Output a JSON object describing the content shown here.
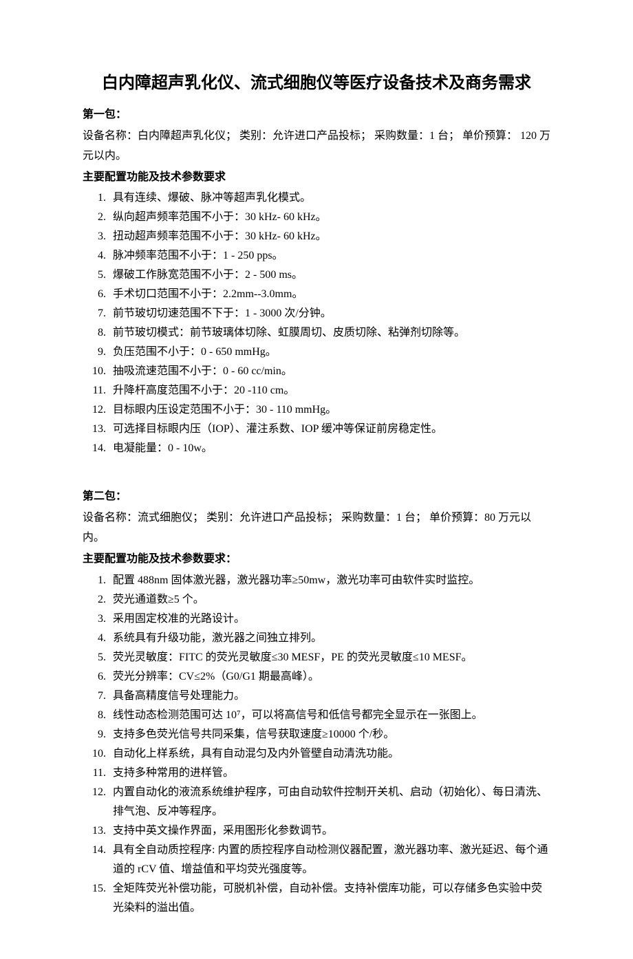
{
  "title": "白内障超声乳化仪、流式细胞仪等医疗设备技术及商务需求",
  "pkg1": {
    "label": "第一包：",
    "info": "设备名称：白内障超声乳化仪；   类别：允许进口产品投标；   采购数量：1 台；  单价预算：  120 万元以内。",
    "config_heading": "主要配置功能及技术参数要求",
    "items": [
      "具有连续、爆破、脉冲等超声乳化模式。",
      "纵向超声频率范围不小于：30 kHz- 60 kHz。",
      "扭动超声频率范围不小于：30 kHz- 60 kHz。",
      "脉冲频率范围不小于：1 - 250 pps。",
      "爆破工作脉宽范围不小于：2 - 500 ms。",
      "手术切口范围不小于：2.2mm--3.0mm。",
      "前节玻切切速范围不下于：1 - 3000 次/分钟。",
      "前节玻切模式：前节玻璃体切除、虹膜周切、皮质切除、粘弹剂切除等。",
      "负压范围不小于：0 - 650 mmHg。",
      "抽吸流速范围不小于：0 - 60 cc/min。",
      "升降杆高度范围不小于：20 -110 cm。",
      "目标眼内压设定范围不小于：30 - 110 mmHg。",
      "可选择目标眼内压（IOP）、灌注系数、IOP 缓冲等保证前房稳定性。",
      "电凝能量：0 - 10w。"
    ]
  },
  "pkg2": {
    "label": "第二包：",
    "info": "设备名称：流式细胞仪；   类别：允许进口产品投标；   采购数量：1 台；  单价预算：80 万元以内。",
    "config_heading": "主要配置功能及技术参数要求：",
    "items": [
      "配置 488nm 固体激光器，激光器功率≥50mw，激光功率可由软件实时监控。",
      "荧光通道数≥5 个。",
      "采用固定校准的光路设计。",
      "系统具有升级功能，激光器之间独立排列。",
      "荧光灵敏度：FITC 的荧光灵敏度≤30 MESF，PE 的荧光灵敏度≤10 MESF。",
      "荧光分辨率：CV≤2%（G0/G1 期最高峰）。",
      "具备高精度信号处理能力。",
      "线性动态检测范围可达 10⁷，可以将高信号和低信号都完全显示在一张图上。",
      "支持多色荧光信号共同采集，信号获取速度≥10000 个/秒。",
      "自动化上样系统，具有自动混匀及内外管壁自动清洗功能。",
      "支持多种常用的进样管。",
      "内置自动化的液流系统维护程序，可由自动软件控制开关机、启动（初始化）、每日清洗、排气泡、反冲等程序。",
      "支持中英文操作界面，采用图形化参数调节。",
      "具有全自动质控程序: 内置的质控程序自动检测仪器配置，激光器功率、激光延迟、每个通道的 rCV 值、增益值和平均荧光强度等。",
      "全矩阵荧光补偿功能，可脱机补偿，自动补偿。支持补偿库功能，可以存储多色实验中荧光染料的溢出值。"
    ]
  }
}
